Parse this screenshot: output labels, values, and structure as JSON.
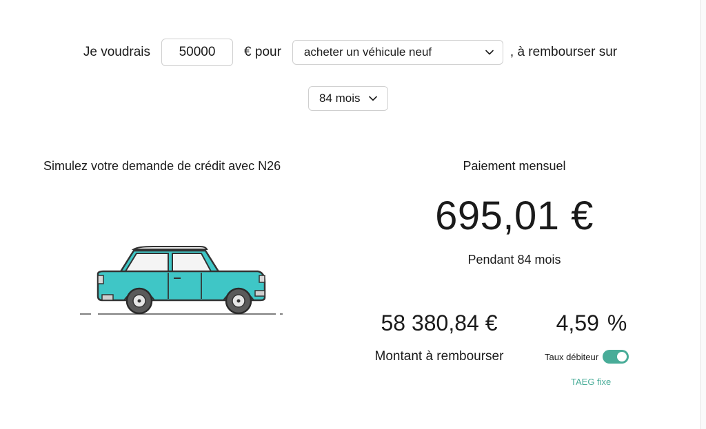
{
  "form": {
    "prefix": "Je voudrais",
    "amount_value": "50000",
    "currency_label": "€ pour",
    "purpose_selected": "acheter un véhicule neuf",
    "suffix": ", à rembourser sur",
    "term_selected": "84 mois"
  },
  "intro": {
    "text": "Simulez votre demande de crédit avec N26"
  },
  "result": {
    "monthly_label": "Paiement mensuel",
    "monthly_value": "695,01 €",
    "duration": "Pendant 84 mois",
    "total_value": "58 380,84 €",
    "total_label": "Montant à rembourser",
    "rate_value": "4,59",
    "rate_unit": "%",
    "rate_type_label": "Taux débiteur",
    "rate_toggle_on": true,
    "taeg_label": "TAEG fixe"
  },
  "colors": {
    "accent": "#48ac98",
    "car_body": "#3fc6c6",
    "text": "#1a1a1a"
  },
  "icons": {
    "purpose_chevron": "chevron-down-icon",
    "term_chevron": "chevron-down-icon",
    "illustration": "car-illustration"
  }
}
